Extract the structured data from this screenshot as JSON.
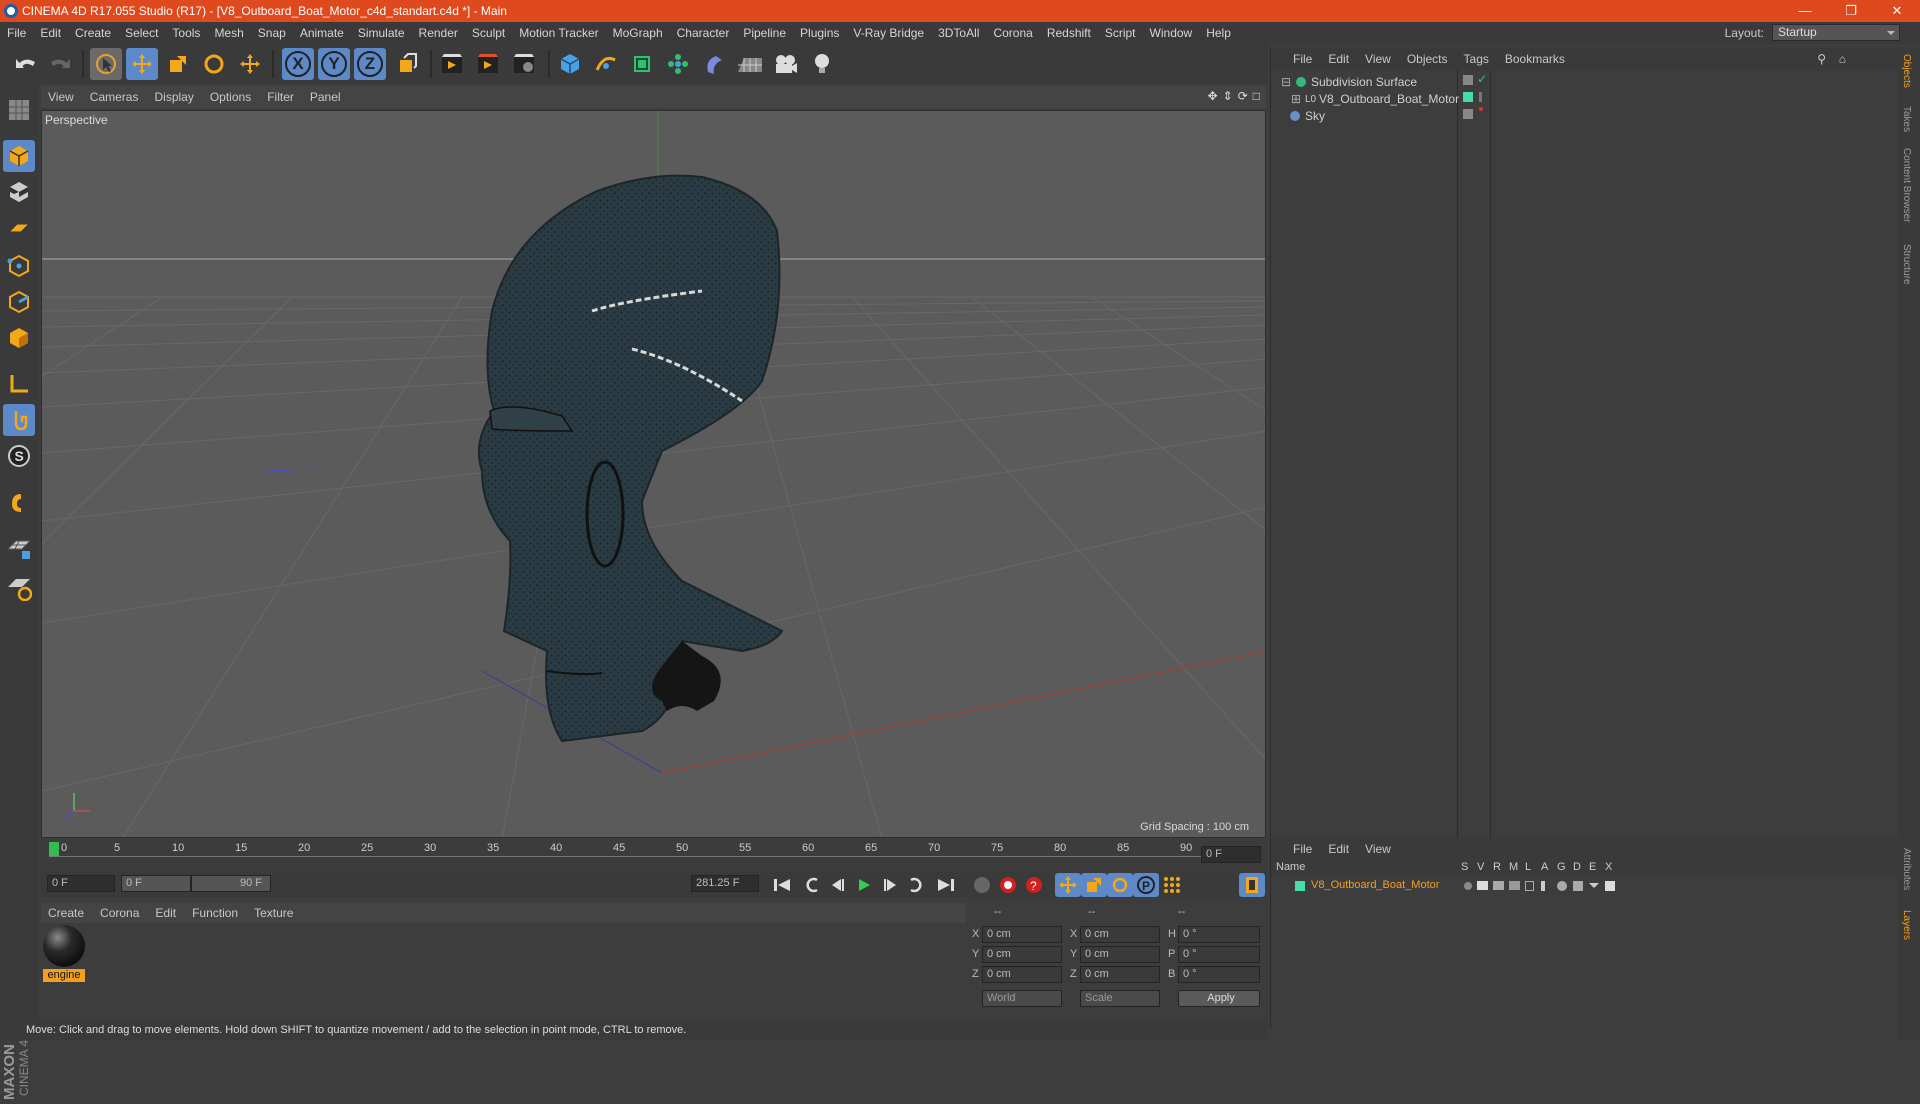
{
  "window": {
    "title": "CINEMA 4D R17.055 Studio (R17) - [V8_Outboard_Boat_Motor_c4d_standart.c4d *] - Main"
  },
  "menubar": [
    "File",
    "Edit",
    "Create",
    "Select",
    "Tools",
    "Mesh",
    "Snap",
    "Animate",
    "Simulate",
    "Render",
    "Sculpt",
    "Motion Tracker",
    "MoGraph",
    "Character",
    "Pipeline",
    "Plugins",
    "V-Ray Bridge",
    "3DToAll",
    "Corona",
    "Redshift",
    "Script",
    "Window",
    "Help"
  ],
  "layout": {
    "label": "Layout:",
    "value": "Startup"
  },
  "toolbar": {
    "x": "X",
    "y": "Y",
    "z": "Z"
  },
  "viewport": {
    "menu": [
      "View",
      "Cameras",
      "Display",
      "Options",
      "Filter",
      "Panel"
    ],
    "label": "Perspective",
    "grid_spacing": "Grid Spacing : 100 cm"
  },
  "timeline": {
    "ticks": [
      "0",
      "5",
      "10",
      "15",
      "20",
      "25",
      "30",
      "35",
      "40",
      "45",
      "50",
      "55",
      "60",
      "65",
      "70",
      "75",
      "80",
      "85",
      "90"
    ],
    "end_field": "0 F",
    "start_field": "0 F",
    "range_start": "0 F",
    "range_end": "90 F",
    "fps_field": "281.25 F"
  },
  "material_menu": [
    "Create",
    "Corona",
    "Edit",
    "Function",
    "Texture"
  ],
  "material": {
    "name": "engine"
  },
  "coords": {
    "header": [
      "--",
      "--",
      "--"
    ],
    "rows": [
      {
        "a": "X",
        "av": "0 cm",
        "b": "X",
        "bv": "0 cm",
        "c": "H",
        "cv": "0 °"
      },
      {
        "a": "Y",
        "av": "0 cm",
        "b": "Y",
        "bv": "0 cm",
        "c": "P",
        "cv": "0 °"
      },
      {
        "a": "Z",
        "av": "0 cm",
        "b": "Z",
        "bv": "0 cm",
        "c": "B",
        "cv": "0 °"
      }
    ],
    "world": "World",
    "scale": "Scale",
    "apply": "Apply"
  },
  "status": "Move: Click and drag to move elements. Hold down SHIFT to quantize movement / add to the selection in point mode, CTRL to remove.",
  "objects": {
    "menu": [
      "File",
      "Edit",
      "View",
      "Objects",
      "Tags",
      "Bookmarks"
    ],
    "items": [
      "Subdivision Surface",
      "V8_Outboard_Boat_Motor",
      "Sky"
    ]
  },
  "layers": {
    "menu": [
      "File",
      "Edit",
      "View"
    ],
    "columns": {
      "name": "Name",
      "flags": [
        "S",
        "V",
        "R",
        "M",
        "L",
        "A",
        "G",
        "D",
        "E",
        "X"
      ]
    },
    "item": "V8_Outboard_Boat_Motor"
  },
  "side_tabs": [
    "Objects",
    "Takes",
    "Content Browser",
    "Structure"
  ],
  "side_tabs_bottom": [
    "Attributes",
    "Layers"
  ],
  "brand": {
    "maxon": "MAXON",
    "product": "CINEMA 4D"
  },
  "colors": {
    "titlebar": "#de4a1d",
    "accent": "#f0a020",
    "highlight": "#5e89c8"
  }
}
